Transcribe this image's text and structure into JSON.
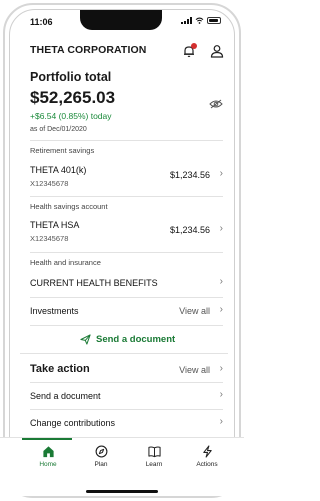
{
  "status_bar": {
    "time": "11:06"
  },
  "header": {
    "company": "THETA CORPORATION"
  },
  "portfolio": {
    "title": "Portfolio total",
    "value": "$52,265.03",
    "change": "+$6.54 (0.85%) today",
    "as_of": "as of Dec/01/2020"
  },
  "retirement": {
    "section_label": "Retirement savings",
    "account_name": "THETA 401(k)",
    "account_number": "X12345678",
    "amount": "$1,234.56"
  },
  "health_savings": {
    "section_label": "Health savings account",
    "account_name": "THETA HSA",
    "account_number": "X12345678",
    "amount": "$1,234.56"
  },
  "health_insurance": {
    "section_label": "Health and insurance",
    "item_label": "CURRENT HEALTH BENEFITS"
  },
  "investments": {
    "label": "Investments",
    "view_all": "View all"
  },
  "send_document_cta": {
    "label": "Send a document"
  },
  "take_action": {
    "title": "Take action",
    "view_all": "View all",
    "items": [
      {
        "label": "Send a document"
      },
      {
        "label": "Change contributions"
      }
    ]
  },
  "tabs": [
    {
      "label": "Home",
      "icon": "home-icon",
      "active": true
    },
    {
      "label": "Plan",
      "icon": "compass-icon",
      "active": false
    },
    {
      "label": "Learn",
      "icon": "book-icon",
      "active": false
    },
    {
      "label": "Actions",
      "icon": "lightning-icon",
      "active": false
    }
  ],
  "colors": {
    "accent_green": "#1a7a35",
    "notification_red": "#d32f2f"
  }
}
